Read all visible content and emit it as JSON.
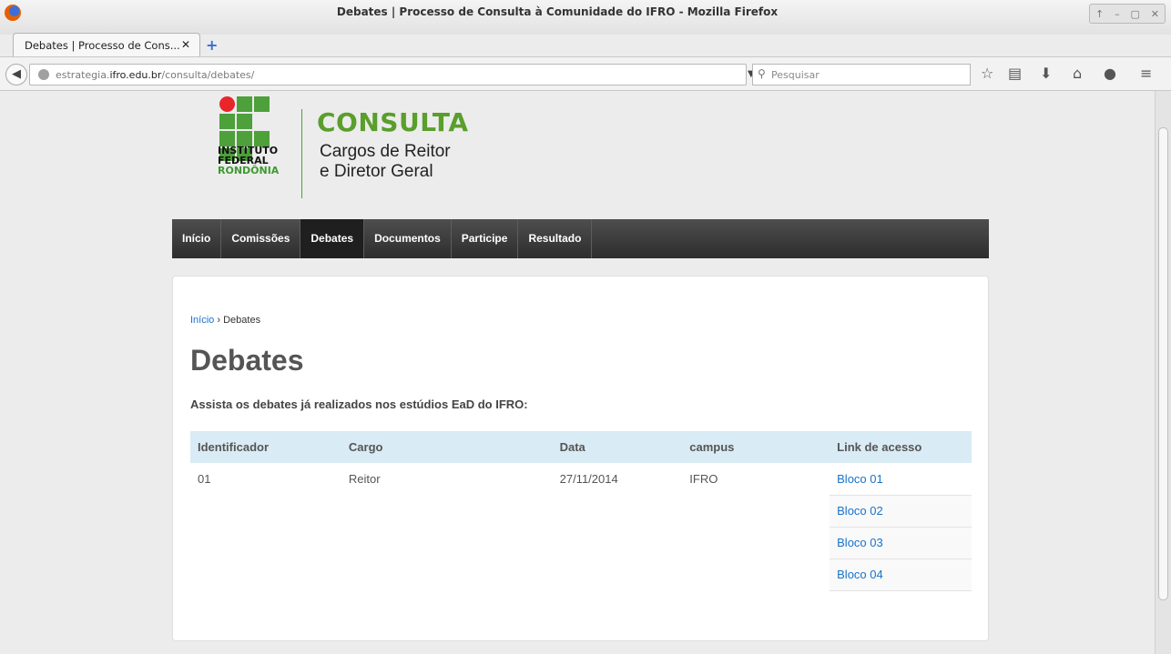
{
  "window": {
    "title": "Debates | Processo de Consulta à Comunidade do IFRO - Mozilla Firefox"
  },
  "tab": {
    "label": "Debates | Processo de Cons...",
    "close": "✕",
    "new_tab": "+"
  },
  "address_bar": {
    "prefix": "estrategia.",
    "domain": "ifro.edu.br",
    "path": "/consulta/debates/"
  },
  "search": {
    "placeholder": "Pesquisar"
  },
  "logo": {
    "line1": "INSTITUTO",
    "line2": "FEDERAL",
    "line3": "RONDÔNIA"
  },
  "header": {
    "title": "CONSULTA",
    "subtitle_line1": "Cargos de Reitor",
    "subtitle_line2": "e Diretor Geral"
  },
  "menu": [
    "Início",
    "Comissões",
    "Debates",
    "Documentos",
    "Participe",
    "Resultado"
  ],
  "breadcrumb": {
    "home": "Início",
    "sep": "›",
    "current": "Debates"
  },
  "page": {
    "title": "Debates",
    "intro": "Assista os debates já realizados nos estúdios EaD do IFRO:"
  },
  "table": {
    "headers": [
      "Identificador",
      "Cargo",
      "Data",
      "campus",
      "Link de acesso"
    ],
    "row": {
      "id": "01",
      "cargo": "Reitor",
      "data": "27/11/2014",
      "campus": "IFRO"
    },
    "links": [
      "Bloco 01",
      "Bloco 02",
      "Bloco 03",
      "Bloco 04"
    ]
  },
  "colors": {
    "accent_green": "#5a9e2c",
    "link_blue": "#1a73c9",
    "table_header_bg": "#d9ebf4",
    "menu_bg": "#3a3a3a"
  }
}
